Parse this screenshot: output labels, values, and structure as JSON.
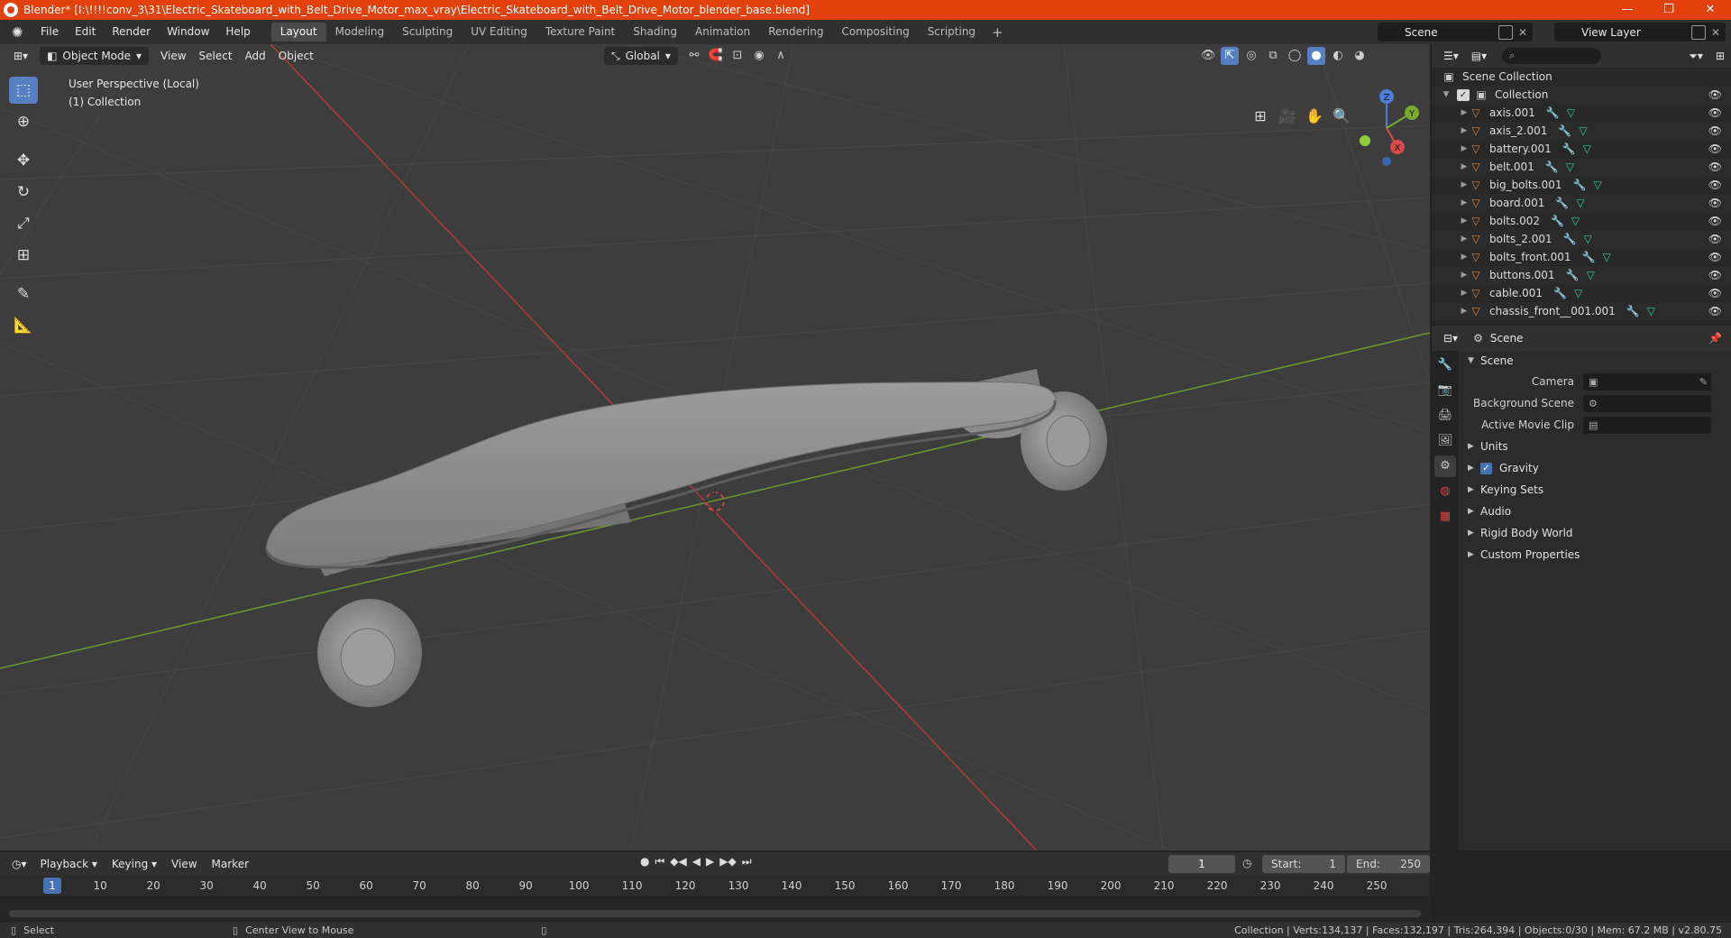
{
  "window": {
    "title": "Blender* [I:\\!!!!conv_3\\31\\Electric_Skateboard_with_Belt_Drive_Motor_max_vray\\Electric_Skateboard_with_Belt_Drive_Motor_blender_base.blend]",
    "controls": [
      "—",
      "❐",
      "✕"
    ]
  },
  "menu": [
    "File",
    "Edit",
    "Render",
    "Window",
    "Help"
  ],
  "workspaces": [
    "Layout",
    "Modeling",
    "Sculpting",
    "UV Editing",
    "Texture Paint",
    "Shading",
    "Animation",
    "Rendering",
    "Compositing",
    "Scripting"
  ],
  "active_workspace": "Layout",
  "scene_selector": "Scene",
  "view_layer_selector": "View Layer",
  "viewport": {
    "mode": "Object Mode",
    "menus": [
      "View",
      "Select",
      "Add",
      "Object"
    ],
    "orientation": "Global",
    "info_line1": "User Perspective (Local)",
    "info_line2": "(1) Collection",
    "gizmo_axes": {
      "z": "Z",
      "y": "Y",
      "x": "X"
    }
  },
  "outliner": {
    "root": "Scene Collection",
    "collection": "Collection",
    "items": [
      "axis.001",
      "axis_2.001",
      "battery.001",
      "belt.001",
      "big_bolts.001",
      "board.001",
      "bolts.002",
      "bolts_2.001",
      "bolts_front.001",
      "buttons.001",
      "cable.001",
      "chassis_front__001.001"
    ]
  },
  "properties": {
    "header": "Scene",
    "panel": "Scene",
    "fields": [
      {
        "label": "Camera",
        "value": ""
      },
      {
        "label": "Background Scene",
        "value": ""
      },
      {
        "label": "Active Movie Clip",
        "value": ""
      }
    ],
    "subpanels": [
      "Units",
      "Gravity",
      "Keying Sets",
      "Audio",
      "Rigid Body World",
      "Custom Properties"
    ],
    "gravity_checked": true
  },
  "timeline": {
    "menus": [
      "Playback",
      "Keying",
      "View",
      "Marker"
    ],
    "current_frame": "1",
    "start_label": "Start:",
    "start": "1",
    "end_label": "End:",
    "end": "250",
    "ticks": [
      "1",
      "10",
      "20",
      "30",
      "40",
      "50",
      "60",
      "70",
      "80",
      "90",
      "100",
      "110",
      "120",
      "130",
      "140",
      "150",
      "160",
      "170",
      "180",
      "190",
      "200",
      "210",
      "220",
      "230",
      "240",
      "250"
    ]
  },
  "statusbar": {
    "left1": "Select",
    "left2": "Center View to Mouse",
    "right": "Collection | Verts:134,137 | Faces:132,197 | Tris:264,394 | Objects:0/30 | Mem: 67.2 MB | v2.80.75"
  },
  "colors": {
    "titlebar": "#e2410b",
    "accent": "#5680c2",
    "x_axis": "#c13a3a",
    "y_axis": "#6c9a2a"
  }
}
